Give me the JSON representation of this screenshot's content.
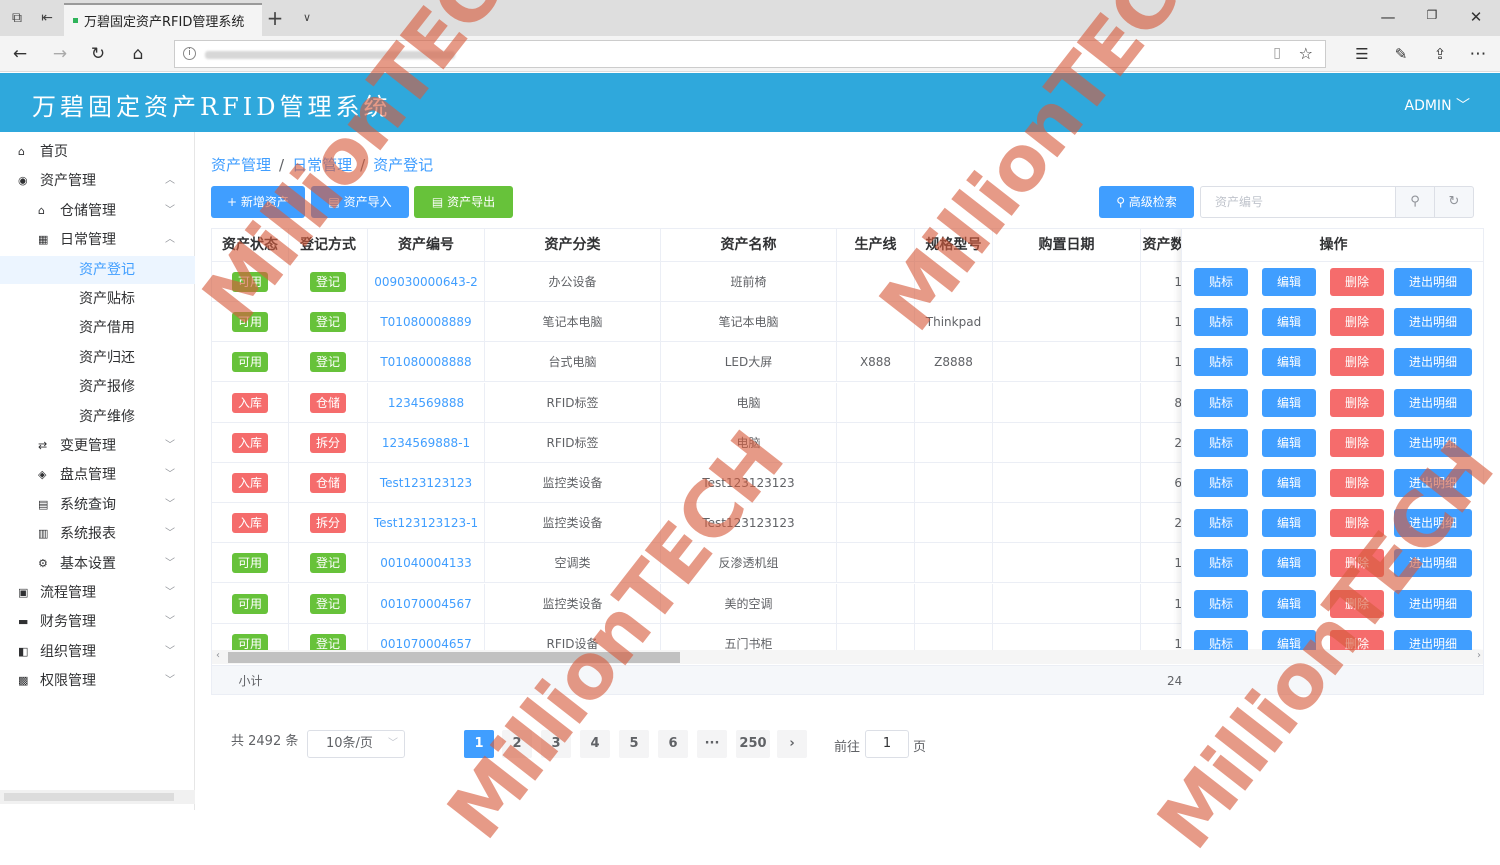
{
  "browser": {
    "tab_title": "万碧固定资产RFID管理系统",
    "new_tab": "+",
    "tab_menu": "∨",
    "minimize": "—",
    "restore": "❐",
    "close": "✕"
  },
  "app": {
    "title": "万碧固定资产RFID管理系统",
    "user": "ADMIN",
    "header_color": "#2fa8dc",
    "accent_color": "#409eff"
  },
  "sidebar": {
    "items": [
      {
        "label": "首页",
        "icon": "home-icon"
      },
      {
        "label": "资产管理",
        "icon": "database-icon",
        "expanded": true
      },
      {
        "label": "仓储管理",
        "icon": "warehouse-icon"
      },
      {
        "label": "日常管理",
        "icon": "calendar-icon",
        "expanded": true
      },
      {
        "label": "资产登记",
        "active": true
      },
      {
        "label": "资产贴标"
      },
      {
        "label": "资产借用"
      },
      {
        "label": "资产归还"
      },
      {
        "label": "资产报修"
      },
      {
        "label": "资产维修"
      },
      {
        "label": "变更管理",
        "icon": "change-icon"
      },
      {
        "label": "盘点管理",
        "icon": "inventory-icon"
      },
      {
        "label": "系统查询",
        "icon": "query-icon"
      },
      {
        "label": "系统报表",
        "icon": "report-icon"
      },
      {
        "label": "基本设置",
        "icon": "settings-icon"
      },
      {
        "label": "流程管理",
        "icon": "process-icon"
      },
      {
        "label": "财务管理",
        "icon": "finance-icon"
      },
      {
        "label": "组织管理",
        "icon": "org-icon"
      },
      {
        "label": "权限管理",
        "icon": "permission-icon"
      }
    ]
  },
  "breadcrumb": [
    "资产管理",
    "日常管理",
    "资产登记"
  ],
  "toolbar": {
    "add": "新增资产",
    "import": "资产导入",
    "export": "资产导出",
    "advanced_search": "高级检索",
    "search_placeholder": "资产编号"
  },
  "table": {
    "headers": [
      "资产状态",
      "登记方式",
      "资产编号",
      "资产分类",
      "资产名称",
      "生产线",
      "规格型号",
      "购置日期",
      "资产数量"
    ],
    "ops_header": "操作",
    "op_labels": {
      "label": "贴标",
      "edit": "编辑",
      "delete": "删除",
      "detail": "进出明细"
    },
    "rows": [
      {
        "status": "可用",
        "status_type": "g",
        "mode": "登记",
        "mode_type": "g",
        "code": "009030000643-2",
        "category": "办公设备",
        "name": "班前椅",
        "line": "",
        "model": "",
        "date": "",
        "qty": "1"
      },
      {
        "status": "可用",
        "status_type": "g",
        "mode": "登记",
        "mode_type": "g",
        "code": "T01080008889",
        "category": "笔记本电脑",
        "name": "笔记本电脑",
        "line": "",
        "model": "Thinkpad",
        "date": "",
        "qty": "1"
      },
      {
        "status": "可用",
        "status_type": "g",
        "mode": "登记",
        "mode_type": "g",
        "code": "T01080008888",
        "category": "台式电脑",
        "name": "LED大屏",
        "line": "X888",
        "model": "Z8888",
        "date": "",
        "qty": "1"
      },
      {
        "status": "入库",
        "status_type": "r",
        "mode": "仓储",
        "mode_type": "r",
        "code": "1234569888",
        "category": "RFID标签",
        "name": "电脑",
        "line": "",
        "model": "",
        "date": "",
        "qty": "8"
      },
      {
        "status": "入库",
        "status_type": "r",
        "mode": "拆分",
        "mode_type": "r",
        "code": "1234569888-1",
        "category": "RFID标签",
        "name": "电脑",
        "line": "",
        "model": "",
        "date": "",
        "qty": "2"
      },
      {
        "status": "入库",
        "status_type": "r",
        "mode": "仓储",
        "mode_type": "r",
        "code": "Test123123123",
        "category": "监控类设备",
        "name": "Test123123123",
        "line": "",
        "model": "",
        "date": "",
        "qty": "6"
      },
      {
        "status": "入库",
        "status_type": "r",
        "mode": "拆分",
        "mode_type": "r",
        "code": "Test123123123-1",
        "category": "监控类设备",
        "name": "Test123123123",
        "line": "",
        "model": "",
        "date": "",
        "qty": "2"
      },
      {
        "status": "可用",
        "status_type": "g",
        "mode": "登记",
        "mode_type": "g",
        "code": "001040004133",
        "category": "空调类",
        "name": "反渗透机组",
        "line": "",
        "model": "",
        "date": "",
        "qty": "1"
      },
      {
        "status": "可用",
        "status_type": "g",
        "mode": "登记",
        "mode_type": "g",
        "code": "001070004567",
        "category": "监控类设备",
        "name": "美的空调",
        "line": "",
        "model": "",
        "date": "",
        "qty": "1"
      },
      {
        "status": "可用",
        "status_type": "g",
        "mode": "登记",
        "mode_type": "g",
        "code": "001070004657",
        "category": "RFID设备",
        "name": "五门书柜",
        "line": "",
        "model": "",
        "date": "",
        "qty": "1"
      }
    ],
    "summary_label": "小计",
    "summary_qty": "24"
  },
  "pagination": {
    "total": "共 2492 条",
    "page_size": "10条/页",
    "pages": [
      "1",
      "2",
      "3",
      "4",
      "5",
      "6",
      "···",
      "250"
    ],
    "current": "1",
    "next": "›",
    "goto_prefix": "前往",
    "goto_value": "1",
    "goto_suffix": "页"
  },
  "watermark": "MillionTECH"
}
